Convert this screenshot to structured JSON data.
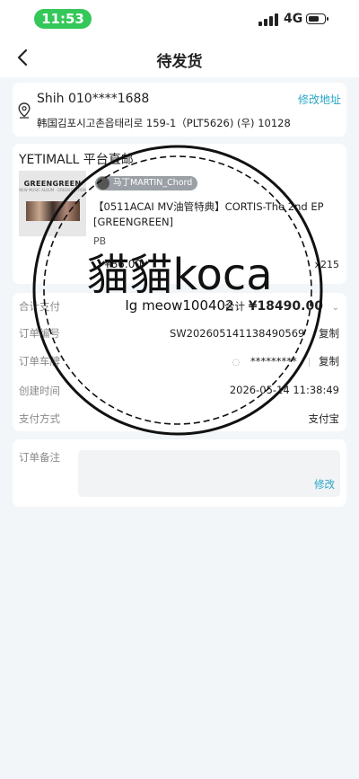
{
  "status": {
    "time": "11:53",
    "network": "4G"
  },
  "nav": {
    "title": "待发货"
  },
  "address": {
    "name_phone": "Shih 010****1688",
    "edit_label": "修改地址",
    "line": "韩国김포시고촌읍태리로 159-1（PLT5626) (우) 10128"
  },
  "product": {
    "shop": "YETIMALL 平台直邮",
    "thumb_brand": "GREENGREEN",
    "thumb_sub": "NEW MUSIC ALBUM · GREEN EDITION",
    "seller": "马丁MARTIN_Chord",
    "title": "【0511ACAI MV油管特典】CORTIS-The 2nd EP [GREENGREEN]",
    "type": "PB",
    "price": "¥86.00",
    "qty": "x215"
  },
  "info": {
    "total_label": "合计支付",
    "total_prefix": "合计",
    "total_amount": "¥18490.00",
    "order_no_label": "订单编号",
    "order_no": "SW202605141138490569",
    "copy_label": "复制",
    "carno_label": "订单车牌",
    "carno": "*********",
    "created_label": "创建时间",
    "created": "2026-05-14 11:38:49",
    "pay_label": "支付方式",
    "pay": "支付宝"
  },
  "remark": {
    "label": "订单备注",
    "edit_label": "修改"
  },
  "watermark": {
    "main": "貓貓koca",
    "sub": "Ig meow100402"
  },
  "colors": {
    "accent": "#2aa7c9",
    "status_green": "#34c759"
  }
}
